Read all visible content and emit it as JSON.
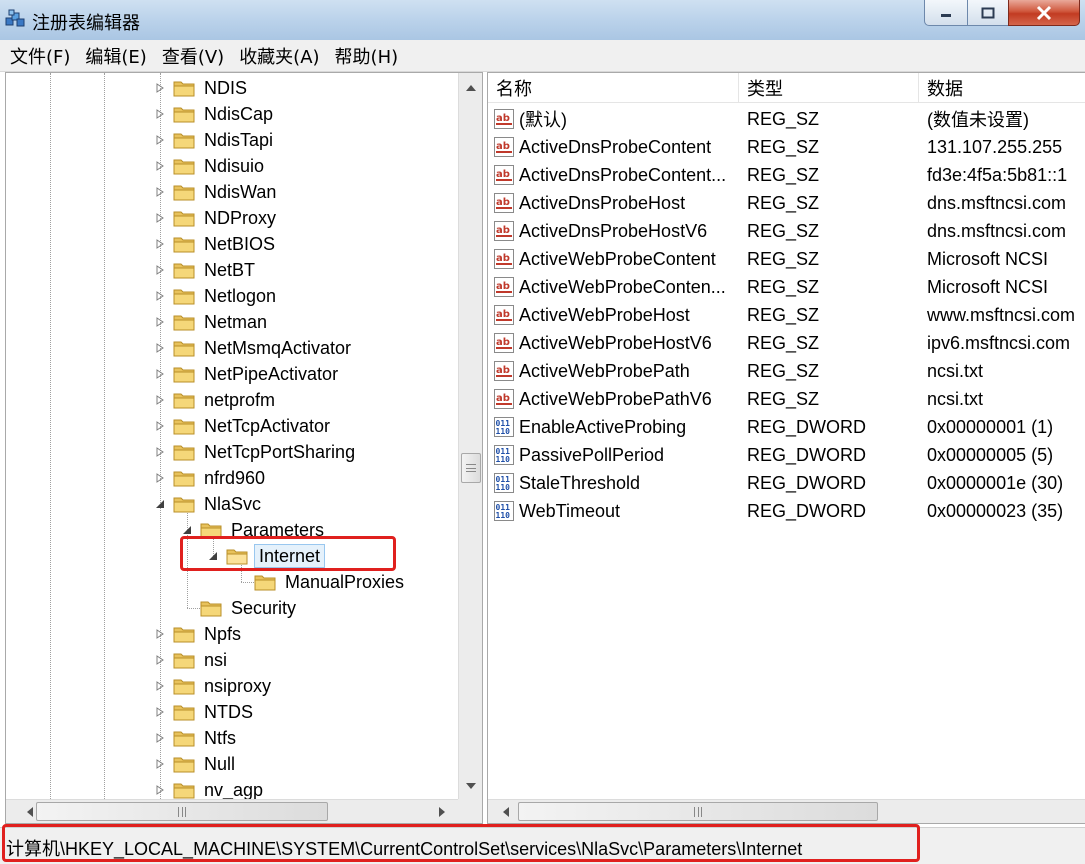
{
  "window": {
    "title": "注册表编辑器"
  },
  "menu": [
    "文件(F)",
    "编辑(E)",
    "查看(V)",
    "收藏夹(A)",
    "帮助(H)"
  ],
  "tree": [
    {
      "label": "NDIS",
      "level": 0,
      "state": "collapsed"
    },
    {
      "label": "NdisCap",
      "level": 0,
      "state": "collapsed"
    },
    {
      "label": "NdisTapi",
      "level": 0,
      "state": "collapsed"
    },
    {
      "label": "Ndisuio",
      "level": 0,
      "state": "collapsed"
    },
    {
      "label": "NdisWan",
      "level": 0,
      "state": "collapsed"
    },
    {
      "label": "NDProxy",
      "level": 0,
      "state": "collapsed"
    },
    {
      "label": "NetBIOS",
      "level": 0,
      "state": "collapsed"
    },
    {
      "label": "NetBT",
      "level": 0,
      "state": "collapsed"
    },
    {
      "label": "Netlogon",
      "level": 0,
      "state": "collapsed"
    },
    {
      "label": "Netman",
      "level": 0,
      "state": "collapsed"
    },
    {
      "label": "NetMsmqActivator",
      "level": 0,
      "state": "collapsed"
    },
    {
      "label": "NetPipeActivator",
      "level": 0,
      "state": "collapsed"
    },
    {
      "label": "netprofm",
      "level": 0,
      "state": "collapsed"
    },
    {
      "label": "NetTcpActivator",
      "level": 0,
      "state": "collapsed"
    },
    {
      "label": "NetTcpPortSharing",
      "level": 0,
      "state": "collapsed"
    },
    {
      "label": "nfrd960",
      "level": 0,
      "state": "collapsed"
    },
    {
      "label": "NlaSvc",
      "level": 0,
      "state": "expanded"
    },
    {
      "label": "Parameters",
      "level": 1,
      "state": "expanded"
    },
    {
      "label": "Internet",
      "level": 2,
      "state": "expanded",
      "selected": true
    },
    {
      "label": "ManualProxies",
      "level": 3,
      "state": "leaf"
    },
    {
      "label": "Security",
      "level": 1,
      "state": "leaf"
    },
    {
      "label": "Npfs",
      "level": 0,
      "state": "collapsed"
    },
    {
      "label": "nsi",
      "level": 0,
      "state": "collapsed"
    },
    {
      "label": "nsiproxy",
      "level": 0,
      "state": "collapsed"
    },
    {
      "label": "NTDS",
      "level": 0,
      "state": "collapsed"
    },
    {
      "label": "Ntfs",
      "level": 0,
      "state": "collapsed"
    },
    {
      "label": "Null",
      "level": 0,
      "state": "collapsed"
    },
    {
      "label": "nv_agp",
      "level": 0,
      "state": "collapsed"
    }
  ],
  "columns": {
    "name": "名称",
    "type": "类型",
    "data": "数据"
  },
  "values": [
    {
      "icon": "string",
      "name": "(默认)",
      "type": "REG_SZ",
      "data": "(数值未设置)"
    },
    {
      "icon": "string",
      "name": "ActiveDnsProbeContent",
      "type": "REG_SZ",
      "data": "131.107.255.255"
    },
    {
      "icon": "string",
      "name": "ActiveDnsProbeContent...",
      "type": "REG_SZ",
      "data": "fd3e:4f5a:5b81::1"
    },
    {
      "icon": "string",
      "name": "ActiveDnsProbeHost",
      "type": "REG_SZ",
      "data": "dns.msftncsi.com"
    },
    {
      "icon": "string",
      "name": "ActiveDnsProbeHostV6",
      "type": "REG_SZ",
      "data": "dns.msftncsi.com"
    },
    {
      "icon": "string",
      "name": "ActiveWebProbeContent",
      "type": "REG_SZ",
      "data": "Microsoft NCSI"
    },
    {
      "icon": "string",
      "name": "ActiveWebProbeConten...",
      "type": "REG_SZ",
      "data": "Microsoft NCSI"
    },
    {
      "icon": "string",
      "name": "ActiveWebProbeHost",
      "type": "REG_SZ",
      "data": "www.msftncsi.com"
    },
    {
      "icon": "string",
      "name": "ActiveWebProbeHostV6",
      "type": "REG_SZ",
      "data": "ipv6.msftncsi.com"
    },
    {
      "icon": "string",
      "name": "ActiveWebProbePath",
      "type": "REG_SZ",
      "data": "ncsi.txt"
    },
    {
      "icon": "string",
      "name": "ActiveWebProbePathV6",
      "type": "REG_SZ",
      "data": "ncsi.txt"
    },
    {
      "icon": "binary",
      "name": "EnableActiveProbing",
      "type": "REG_DWORD",
      "data": "0x00000001 (1)"
    },
    {
      "icon": "binary",
      "name": "PassivePollPeriod",
      "type": "REG_DWORD",
      "data": "0x00000005 (5)"
    },
    {
      "icon": "binary",
      "name": "StaleThreshold",
      "type": "REG_DWORD",
      "data": "0x0000001e (30)"
    },
    {
      "icon": "binary",
      "name": "WebTimeout",
      "type": "REG_DWORD",
      "data": "0x00000023 (35)"
    }
  ],
  "status": {
    "path": "计算机\\HKEY_LOCAL_MACHINE\\SYSTEM\\CurrentControlSet\\services\\NlaSvc\\Parameters\\Internet"
  },
  "colors": {
    "highlight": "#e0201e",
    "selection": "#e5f1fb",
    "string_icon": "#c0392b",
    "binary_icon": "#1f4fa8"
  }
}
